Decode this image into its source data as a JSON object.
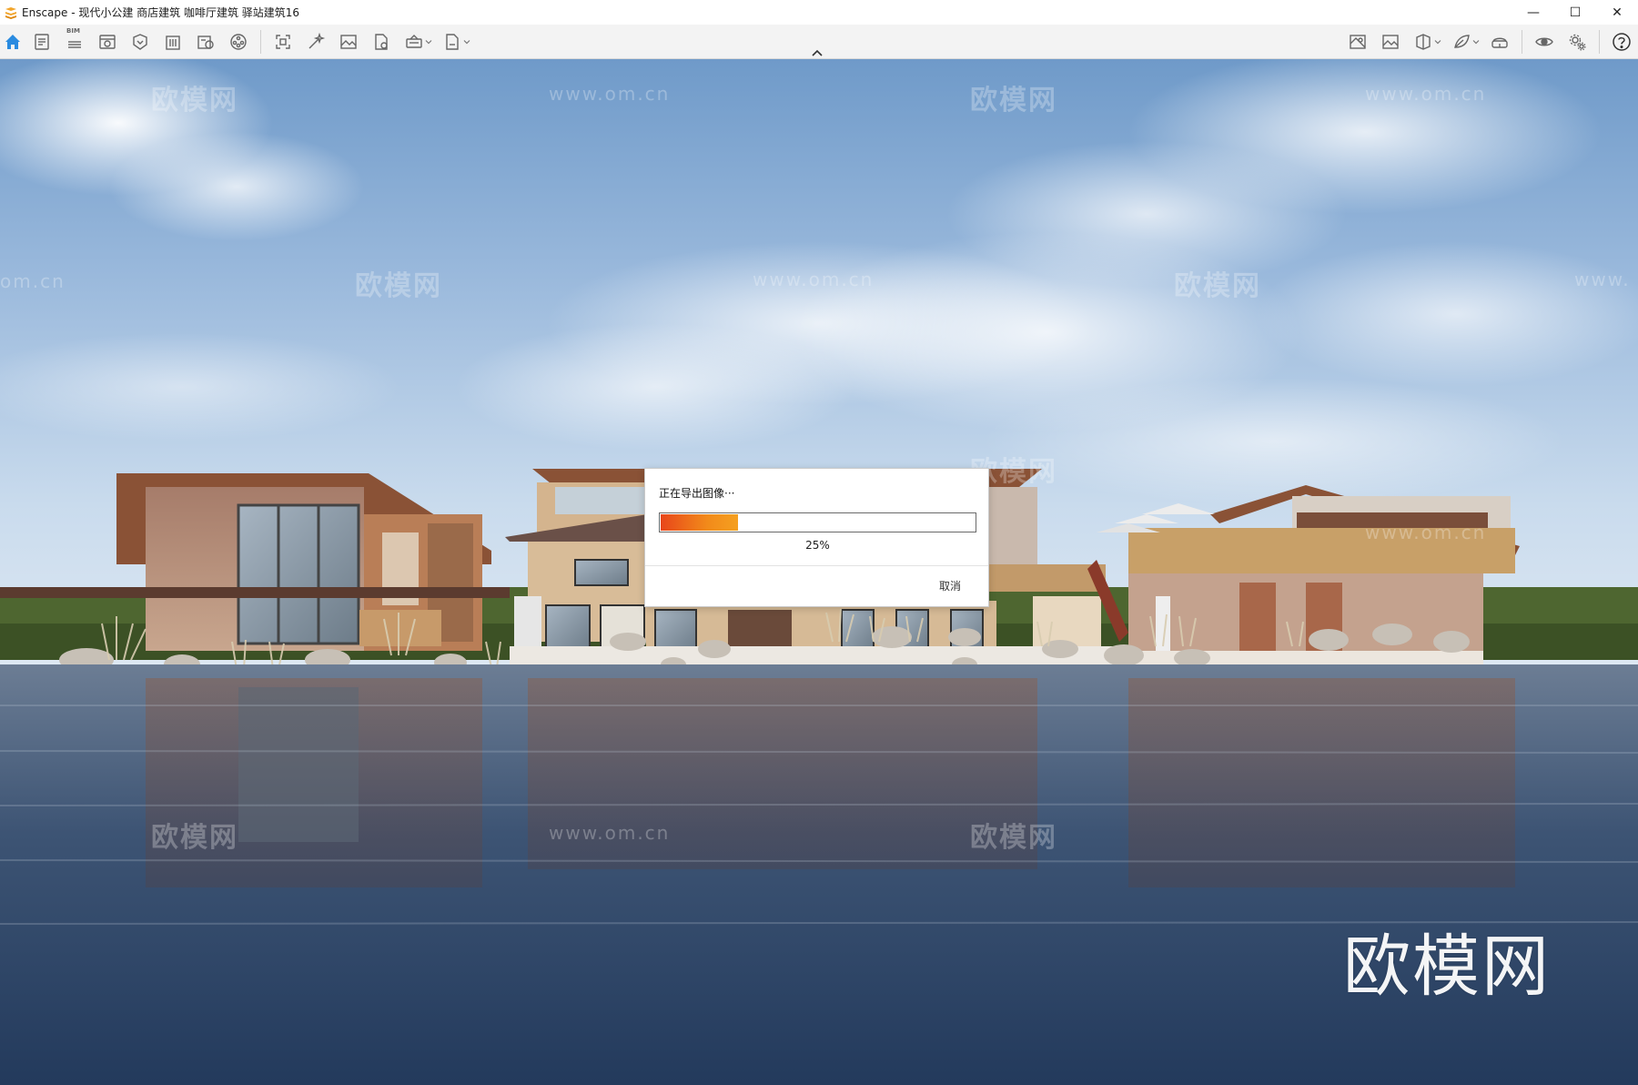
{
  "window": {
    "title": "Enscape - 现代小公建 商店建筑 咖啡厅建筑 驿站建筑16",
    "controls": {
      "minimize": "—",
      "maximize": "☐",
      "close": "✕"
    }
  },
  "toolbar": {
    "bim_label": "BIM",
    "left_icons": [
      "home-icon",
      "documentation-icon",
      "bim-info-icon",
      "visual-settings-icon",
      "asset-library-icon",
      "building-icon",
      "material-editor-icon",
      "video-editor-icon",
      "screenshot-icon",
      "batch-render-icon",
      "panorama-icon",
      "export-file-icon",
      "upload-icon",
      "export-exe-icon"
    ],
    "right_icons": [
      "minimap-icon",
      "views-icon",
      "section-icon",
      "sun-icon",
      "vr-headset-icon",
      "visibility-icon",
      "settings-icon",
      "help-icon"
    ]
  },
  "watermarks": {
    "brand": "欧模网",
    "url": "www.om.cn",
    "url_partial_left": "om.cn",
    "url_partial_right": "www."
  },
  "dialog": {
    "title": "正在导出图像···",
    "progress": 0.25,
    "progress_label": "25%",
    "cancel_label": "取消"
  },
  "colors": {
    "accent": "#f0881a",
    "progress_start": "#e8461a",
    "progress_end": "#f5a020",
    "home_icon": "#2a8be0",
    "logo": "#f2a52b"
  }
}
